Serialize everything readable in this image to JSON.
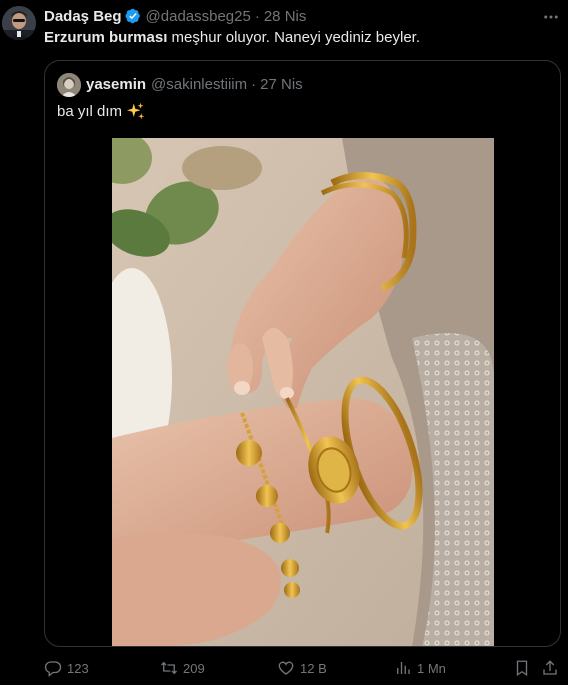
{
  "tweet": {
    "display_name": "Dadaş Beg",
    "handle": "@dadassbeg25",
    "separator": "·",
    "time": "28 Nis",
    "text_bold": "Erzurum burması",
    "text_rest": " meşhur oluyor. Naneyi yediniz beyler."
  },
  "quote": {
    "display_name": "yasemin",
    "handle": "@sakinlestiiim",
    "separator": "·",
    "time": "27 Nis",
    "text": "ba yıl dım",
    "emoji_icon": "sparkles-icon"
  },
  "actions": {
    "replies": "123",
    "retweets": "209",
    "likes": "12 B",
    "views": "1 Mn"
  },
  "colors": {
    "background": "#000000",
    "text_primary": "#e7e9ea",
    "text_secondary": "#71767b",
    "border": "#2f3336",
    "verified": "#1d9bf0",
    "gold": "#d4a23a"
  }
}
